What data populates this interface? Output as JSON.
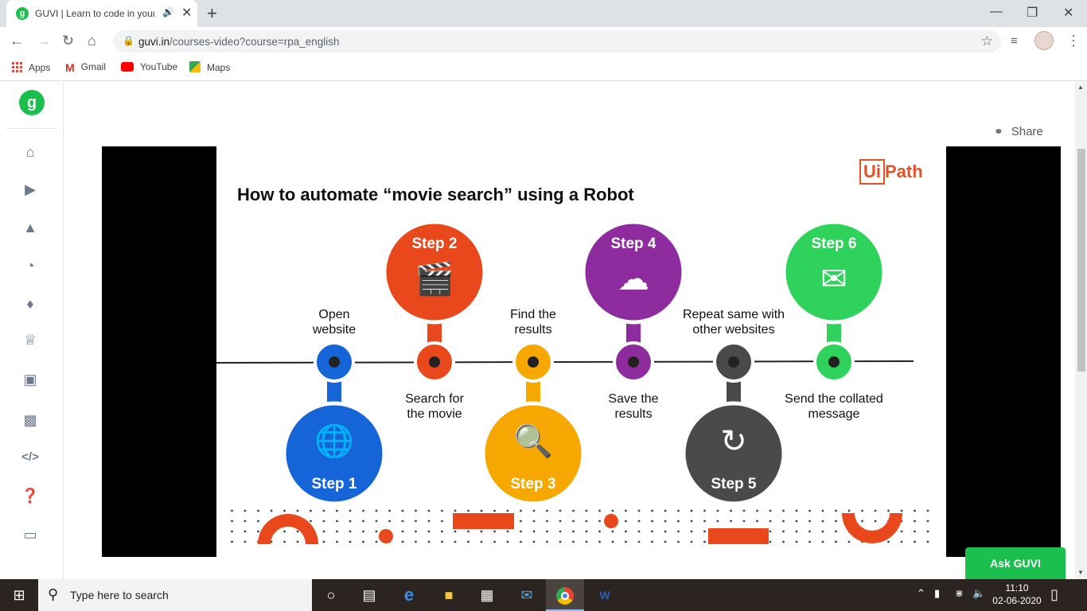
{
  "browser": {
    "tab_title": "GUVI | Learn to code in your",
    "new_tab": "+",
    "url_host": "guvi.in",
    "url_path": "/courses-video?course=rpa_english",
    "bookmarks": [
      "Apps",
      "Gmail",
      "YouTube",
      "Maps"
    ]
  },
  "sidebar": {
    "logo": "g",
    "items": [
      "home-icon",
      "video-library-icon",
      "shapes-icon",
      "progress-icon",
      "tag-icon",
      "crown-icon",
      "gift-icon",
      "briefcase-icon",
      "code-icon",
      "help-icon",
      "chat-icon"
    ]
  },
  "main": {
    "share_label": "Share",
    "ask_guvi": "Ask GUVI"
  },
  "slide": {
    "title": "How to automate “movie search” using a Robot",
    "brand": "UiPath",
    "steps": [
      {
        "label": "Step 1",
        "caption_line1": "Open",
        "caption_line2": "website",
        "color": "#1565d8",
        "icon": "laptop-globe-icon"
      },
      {
        "label": "Step 2",
        "caption_line1": "Search for",
        "caption_line2": "the movie",
        "color": "#e8481c",
        "icon": "clapperboard-icon"
      },
      {
        "label": "Step 3",
        "caption_line1": "Find the",
        "caption_line2": "results",
        "color": "#f6a800",
        "icon": "search-pulse-icon"
      },
      {
        "label": "Step 4",
        "caption_line1": "Save the",
        "caption_line2": "results",
        "color": "#8e2b9e",
        "icon": "cloud-download-icon"
      },
      {
        "label": "Step 5",
        "caption_line1": "Repeat same with",
        "caption_line2": "other websites",
        "color": "#4a4a4a",
        "icon": "refresh-icon"
      },
      {
        "label": "Step 6",
        "caption_line1": "Send the collated",
        "caption_line2": "message",
        "color": "#2fd25a",
        "icon": "email-icon"
      }
    ]
  },
  "taskbar": {
    "search_placeholder": "Type here to search",
    "time": "11:10",
    "date": "02-06-2020"
  }
}
